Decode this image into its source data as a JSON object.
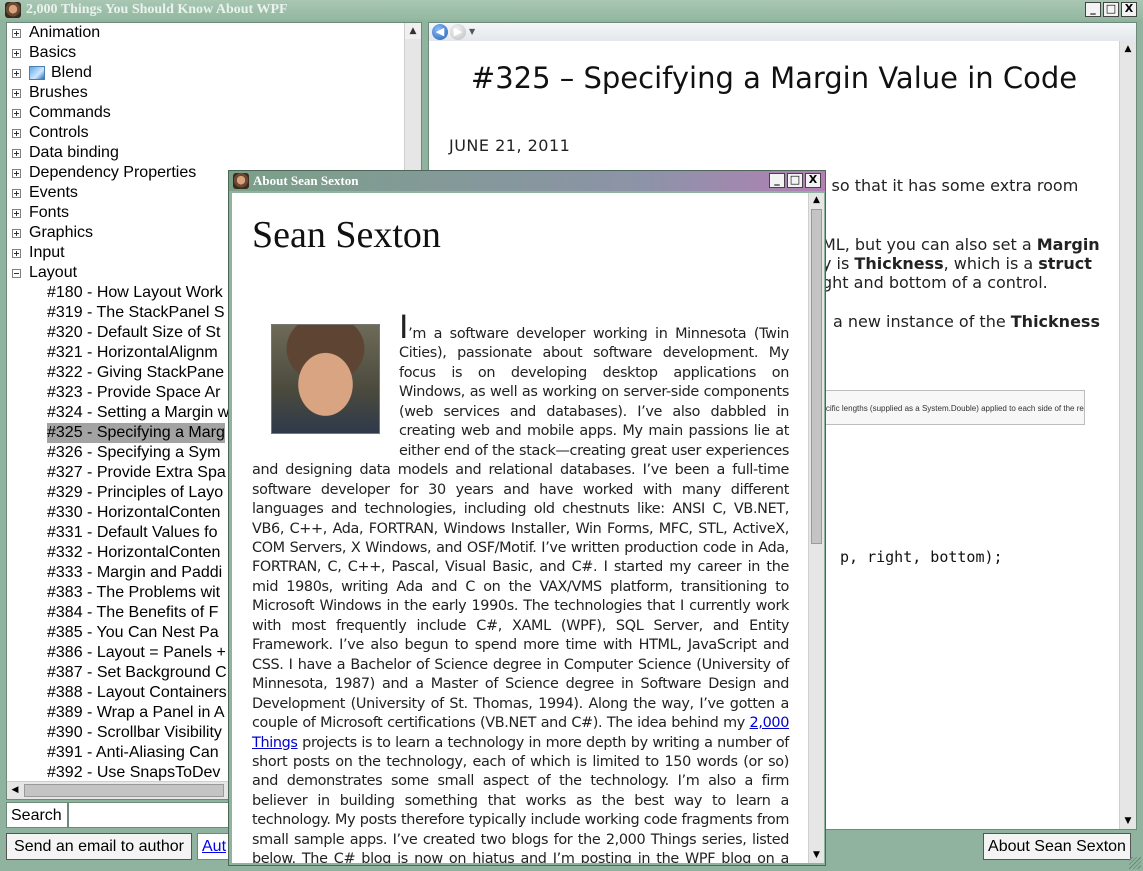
{
  "app": {
    "title": "2,000 Things You Should Know About WPF"
  },
  "window_buttons": {
    "minimize": "_",
    "maximize": "□",
    "close": "X"
  },
  "tree": {
    "categories": [
      {
        "label": "Animation",
        "state": "plus"
      },
      {
        "label": "Basics",
        "state": "plus"
      },
      {
        "label": "Blend",
        "state": "plus",
        "icon": "blend-icon"
      },
      {
        "label": "Brushes",
        "state": "plus"
      },
      {
        "label": "Commands",
        "state": "plus"
      },
      {
        "label": "Controls",
        "state": "plus"
      },
      {
        "label": "Data binding",
        "state": "plus"
      },
      {
        "label": "Dependency Properties",
        "state": "plus"
      },
      {
        "label": "Events",
        "state": "plus"
      },
      {
        "label": "Fonts",
        "state": "plus"
      },
      {
        "label": "Graphics",
        "state": "plus"
      },
      {
        "label": "Input",
        "state": "plus"
      },
      {
        "label": "Layout",
        "state": "minus"
      }
    ],
    "layout_children": [
      "#180 - How Layout Work",
      "#319 - The StackPanel S",
      "#320 - Default Size of St",
      "#321 - HorizontalAlignm",
      "#322 - Giving StackPane",
      "#323 - Provide Space Ar",
      "#324 - Setting a Margin w",
      "#325 - Specifying a Marg",
      "#326 - Specifying a Sym",
      "#327 - Provide Extra Spa",
      "#329 - Principles of Layo",
      "#330 - HorizontalConten",
      "#331 - Default Values fo",
      "#332 - HorizontalConten",
      "#333 - Margin and Paddi",
      "#383 - The Problems wit",
      "#384 - The Benefits of F",
      "#385 - You Can Nest Pa",
      "#386 - Layout = Panels +",
      "#387 - Set Background C",
      "#388 - Layout Containers",
      "#389 - Wrap a Panel in A",
      "#390 - Scrollbar Visibility",
      "#391 - Anti-Aliasing Can",
      "#392 - Use SnapsToDev"
    ],
    "selected_child_index": 7
  },
  "search": {
    "label": "Search",
    "value": "",
    "placeholder": ""
  },
  "buttons": {
    "email": "Send an email to author",
    "author_link": "Aut",
    "about": "About Sean Sexton"
  },
  "browser": {
    "post_title": "#325 – Specifying a Margin Value in Code",
    "post_date": "JUNE 21, 2011",
    "fragments": {
      "line1": "l so that it has some extra room",
      "line2a": "ML, but you can also set a ",
      "line2b": "Margin",
      "line3a": "y is ",
      "line3b": "Thickness",
      "line3c": ", which is a ",
      "line3d": "struct",
      "line4": "ght and bottom of a control.",
      "line5a": "a new instance of the ",
      "line5b": "Thickness",
      "doc_box": "specific lengths (supplied as a System.Double) applied to each side of the rectangle.",
      "code": "p, right, bottom);"
    }
  },
  "about_dialog": {
    "title": "About Sean Sexton",
    "heading": "Sean Sexton",
    "bio_dropcap": "I",
    "bio_part1": "’m a software developer working in Minnesota (Twin Cities), passionate about software development. My focus is on developing desktop applications on Windows, as well as working on server-side components (web services and databases). I’ve also dabbled in creating web and mobile apps. My main passions lie at either end of the stack—creati­ng great user experiences and designing data models and relational databases. I’ve been a full-time software developer for 30 years and have worked with many different languages and technologies, including old chestnuts like: ANSI C, VB.NET, VB6, C++, Ada, FORTRAN, Windows Installer, Win Forms, MFC, STL, ActiveX, COM Servers, X Windows, and OSF/Motif. I’ve written production code in Ada, FORTRAN, C, C++, Pascal, Visual Basic, and C#. I started my career in the mid 1980s, writing Ada and C on the VAX/VMS platform, transitioning to Microsoft Windows in the early 1990s. The technologies that I currently work with most frequently include C#, XAML (WPF), SQL Server, and Entity Framework. I’ve also begun to spend more time with HTML, JavaScript and CSS. I have a Bachelor of Science degree in Computer Science (University of Minnesota, 1987) and a Master of Science degree in Software Design and Development (University of St. Thomas, 1994). Along the way, I’ve gotten a couple of Microsoft certifications (VB.NET and C#). The idea behind my ",
    "bio_link": "2,000 Things",
    "bio_part2": " projects is to learn a technology in more depth by writing a number of short posts on the technology, each of which is li­mited to 150 words (or so) and demonstrates some small aspect of the technology. I’m also a firm believer in building something that works as the best way to learn a technology. My posts therefore typically include working code fragments from small sample apps. I’ve created two blogs for the 2,000 Things series, listed below. The C# blog is now on hiatus and I’m posting in the WPF blog on a fairly limited basis."
  },
  "colors": {
    "window_frame": "#8fb39e",
    "selection": "#a3a3a3",
    "link": "#0000cc"
  }
}
